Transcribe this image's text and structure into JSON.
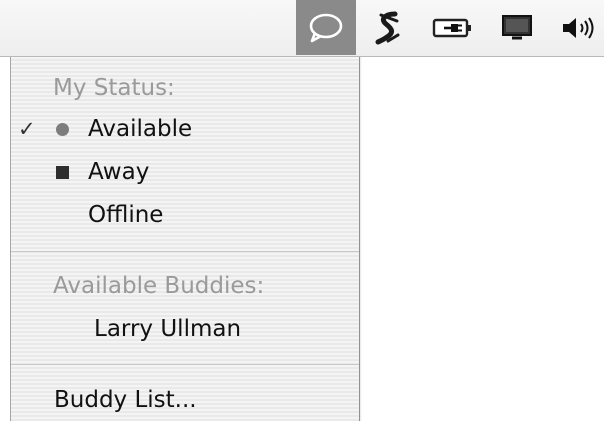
{
  "menubar": {
    "icons": [
      "ichat-bubble-icon",
      "script-icon",
      "battery-plug-icon",
      "display-icon",
      "volume-icon"
    ],
    "active_bg": "#8a8a8a"
  },
  "menu": {
    "status_header": "My Status:",
    "check_mark": "✓",
    "status_items": {
      "available": "Available",
      "away": "Away",
      "offline": "Offline"
    },
    "buddies_header": "Available Buddies:",
    "buddies": [
      "Larry Ullman"
    ],
    "buddy_list_item": "Buddy List..."
  }
}
